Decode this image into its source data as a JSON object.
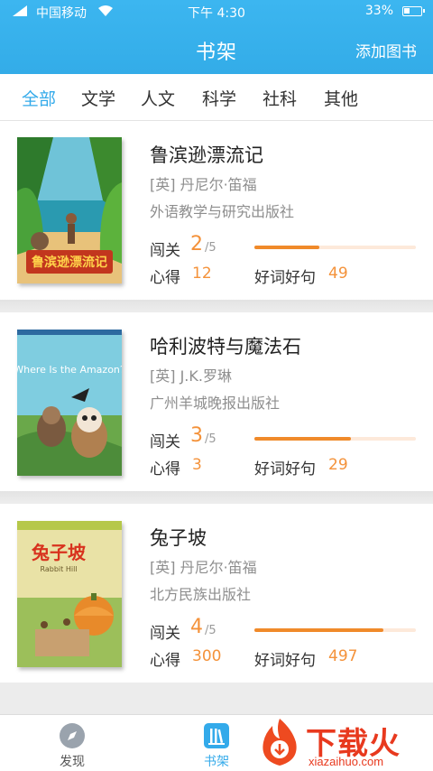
{
  "status_bar": {
    "carrier": "中国移动",
    "time": "下午 4:30",
    "battery": "33%"
  },
  "nav": {
    "title": "书架",
    "action": "添加图书"
  },
  "tabs": [
    {
      "label": "全部",
      "active": true
    },
    {
      "label": "文学",
      "active": false
    },
    {
      "label": "人文",
      "active": false
    },
    {
      "label": "科学",
      "active": false
    },
    {
      "label": "社科",
      "active": false
    },
    {
      "label": "其他",
      "active": false
    }
  ],
  "stat_labels": {
    "level": "闯关",
    "notes": "心得",
    "phrases": "好词好句"
  },
  "books": [
    {
      "title": "鲁滨逊漂流记",
      "author": "[英] 丹尼尔·笛福",
      "publisher": "外语教学与研究出版社",
      "level_current": "2",
      "level_total": "/5",
      "progress": 0.4,
      "notes": "12",
      "phrases": "49",
      "cover_text": "鲁滨逊漂流记"
    },
    {
      "title": "哈利波特与魔法石",
      "author": "[英] J.K.罗琳",
      "publisher": "广州羊城晚报出版社",
      "level_current": "3",
      "level_total": "/5",
      "progress": 0.6,
      "notes": "3",
      "phrases": "29",
      "cover_text": "Where Is the Amazon?"
    },
    {
      "title": "兔子坡",
      "author": "[英] 丹尼尔·笛福",
      "publisher": "北方民族出版社",
      "level_current": "4",
      "level_total": "/5",
      "progress": 0.8,
      "notes": "300",
      "phrases": "497",
      "cover_text": "兔子坡",
      "cover_subtext": "Rabbit Hill"
    }
  ],
  "bottom_nav": [
    {
      "label": "发现",
      "icon": "compass-icon",
      "active": false
    },
    {
      "label": "书架",
      "icon": "bookshelf-icon",
      "active": true
    }
  ],
  "watermark": {
    "text": "下载火",
    "url": "xiazaihuo.com"
  },
  "colors": {
    "primary": "#33aaea",
    "accent": "#f4923a",
    "progress_track": "#fde9da"
  }
}
